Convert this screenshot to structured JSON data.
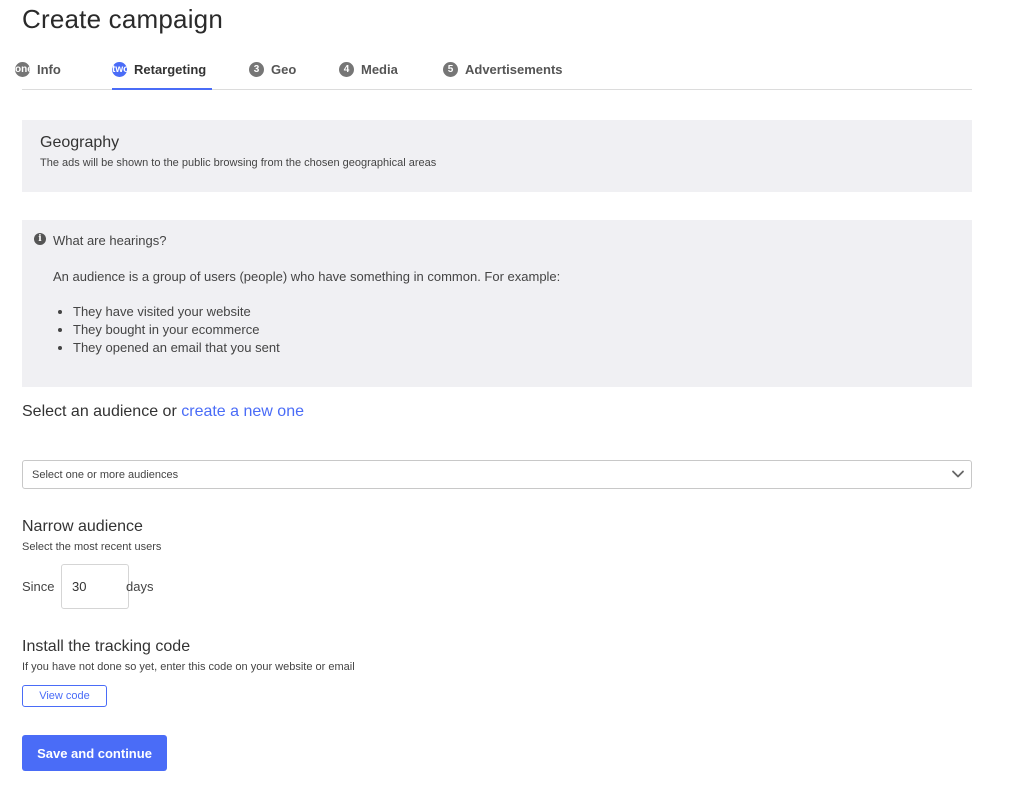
{
  "page": {
    "title": "Create campaign"
  },
  "tabs": [
    {
      "number": "one",
      "label": "Info",
      "active": false
    },
    {
      "number": "two",
      "label": "Retargeting",
      "active": true
    },
    {
      "number": "3",
      "label": "Geo",
      "active": false
    },
    {
      "number": "4",
      "label": "Media",
      "active": false
    },
    {
      "number": "5",
      "label": "Advertisements",
      "active": false
    }
  ],
  "geography": {
    "title": "Geography",
    "subtitle": "The ads will be shown to the public browsing from the chosen geographical areas"
  },
  "info": {
    "icon": "info-circle-icon",
    "title": "What are hearings?",
    "text": "An audience is a group of users (people) who have something in common. For example:",
    "items": [
      "They have visited your website",
      "They bought in your ecommerce",
      "They opened an email that you sent"
    ]
  },
  "audience": {
    "heading_prefix": "Select an audience or",
    "create_link": "create a new one",
    "dropdown_placeholder": "Select one or more audiences",
    "dropdown_icon": "chevron-down-icon"
  },
  "narrow": {
    "title": "Narrow audience",
    "subtitle": "Select the most recent users",
    "since_label": "Since",
    "since_value": "30",
    "days_label": "days"
  },
  "tracking": {
    "title": "Install the tracking code",
    "subtitle": "If you have not done so yet, enter this code on your website or email",
    "view_code_label": "View code"
  },
  "actions": {
    "save_label": "Save and continue"
  },
  "colors": {
    "accent": "#4a6cf7",
    "panel_bg": "#f0f0f3",
    "tab_badge": "#767676"
  }
}
